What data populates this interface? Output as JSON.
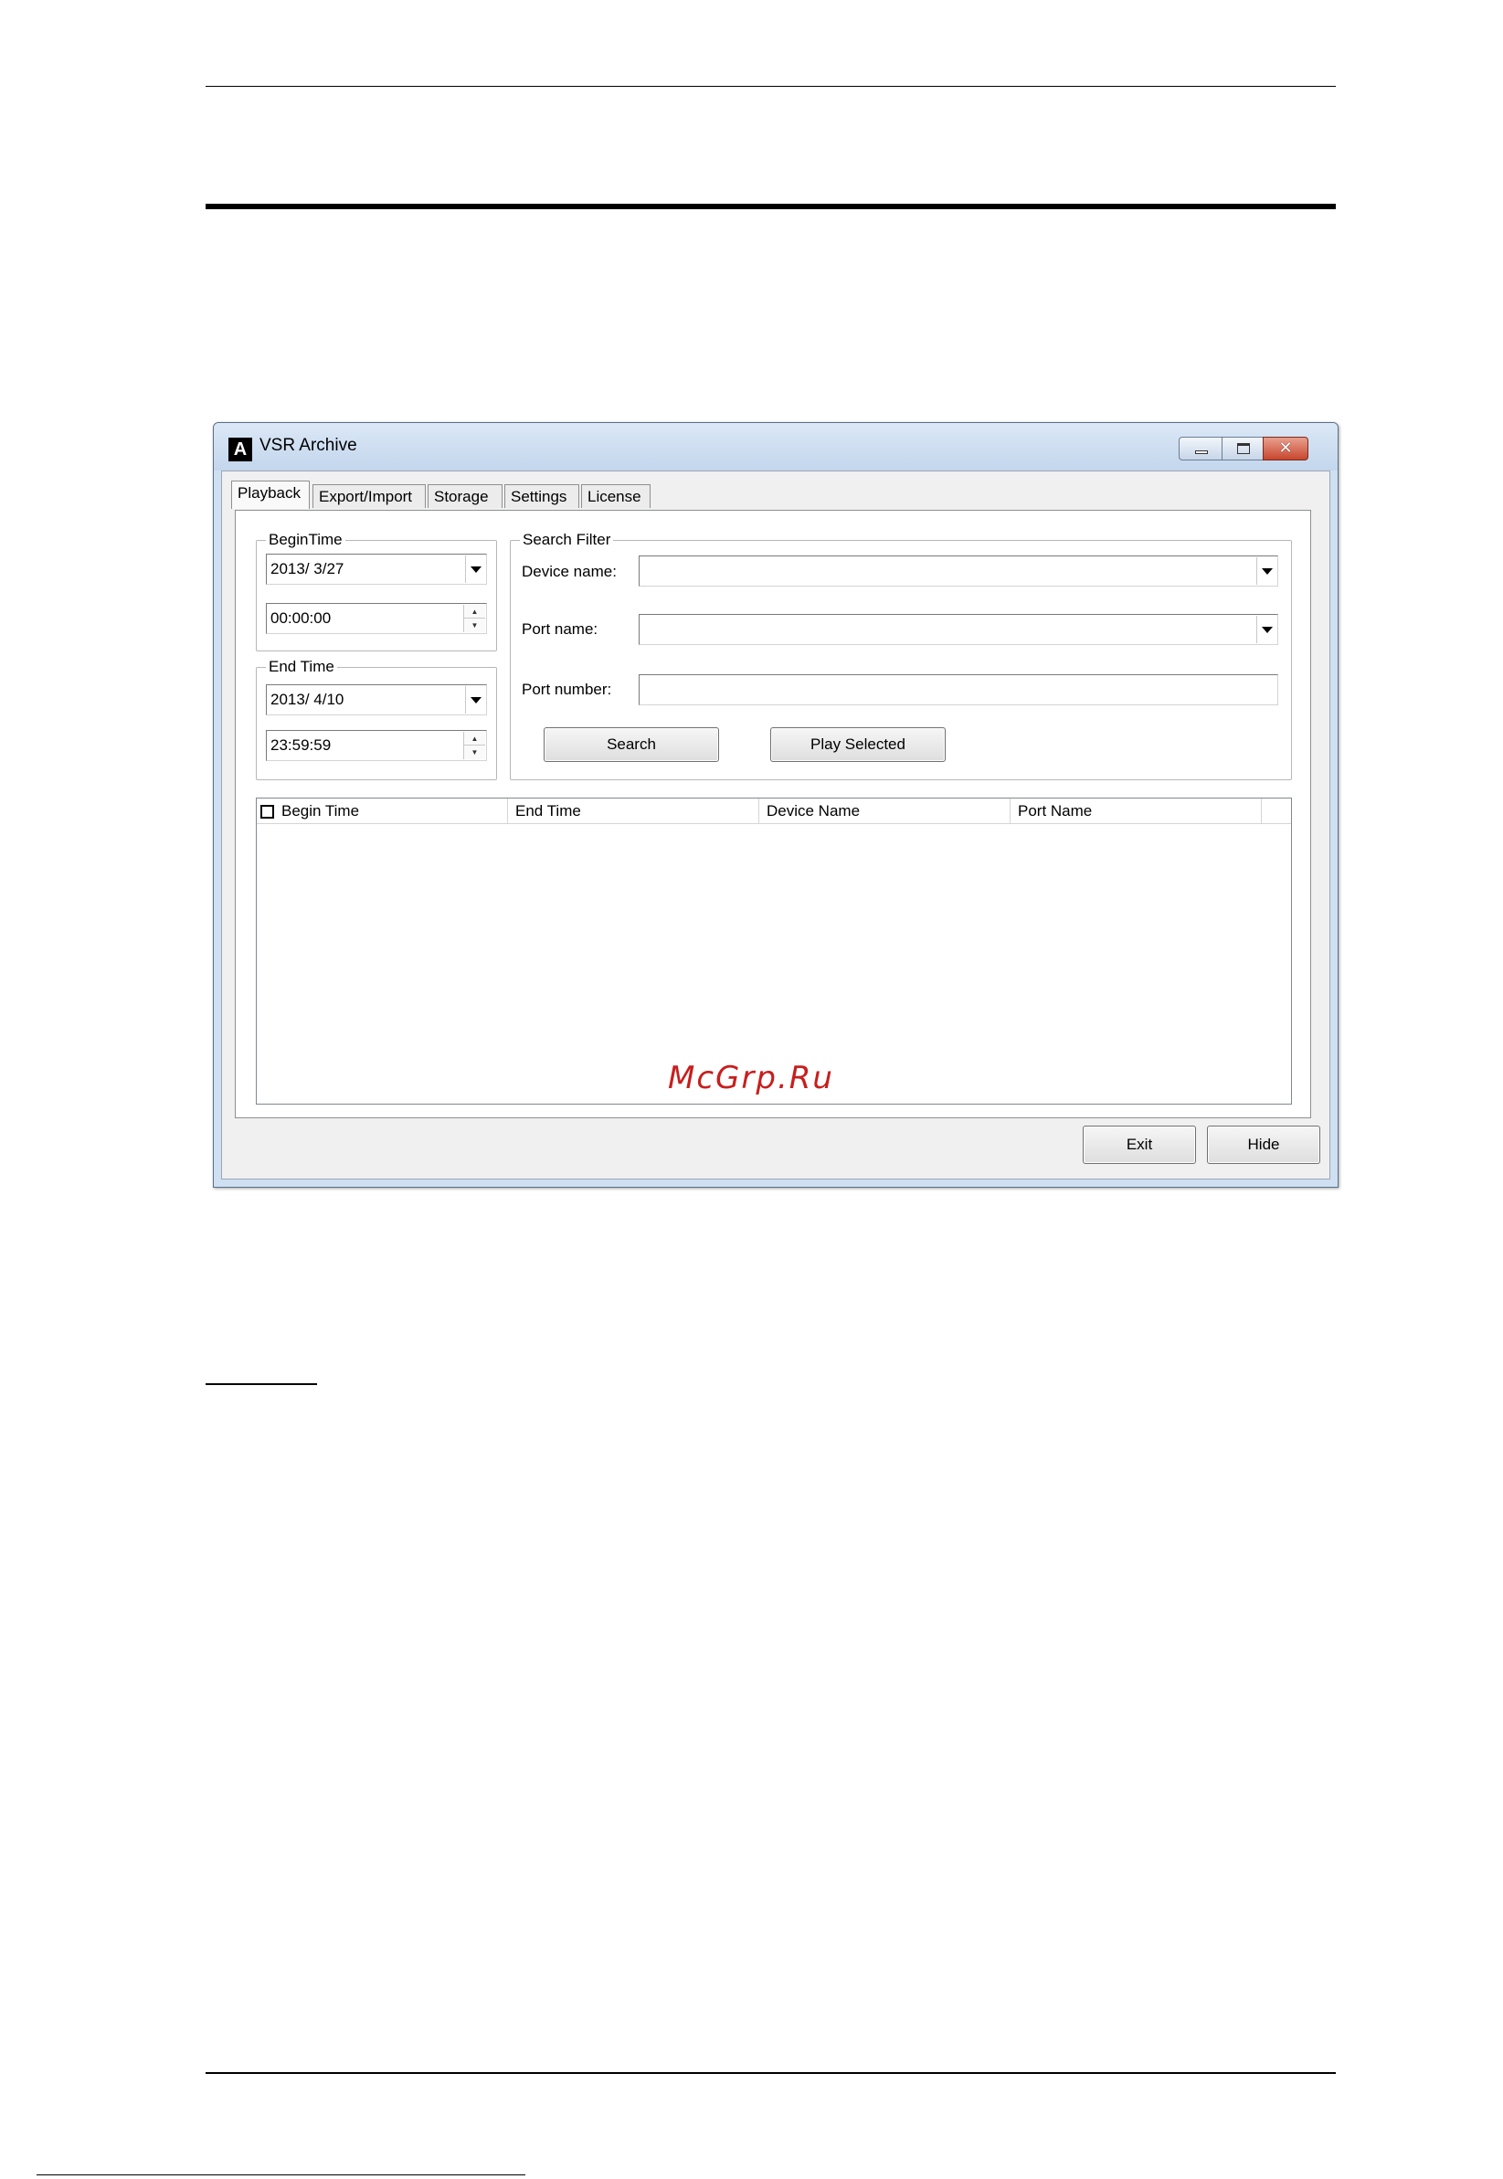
{
  "window": {
    "title": "VSR Archive",
    "icon": "aten-a-logo-icon",
    "controls": [
      "minimize-icon",
      "maximize-icon",
      "close-icon"
    ]
  },
  "tabs": [
    {
      "label": "Playback",
      "active": true
    },
    {
      "label": "Export/Import",
      "active": false
    },
    {
      "label": "Storage",
      "active": false
    },
    {
      "label": "Settings",
      "active": false
    },
    {
      "label": "License",
      "active": false
    }
  ],
  "begin_time": {
    "group_label": "BeginTime",
    "date": "2013/  3/27",
    "time": "00:00:00"
  },
  "end_time": {
    "group_label": "End Time",
    "date": "2013/  4/10",
    "time": "23:59:59"
  },
  "search_filter": {
    "group_label": "Search Filter",
    "device_name_label": "Device name:",
    "device_name_value": "",
    "port_name_label": "Port name:",
    "port_name_value": "",
    "port_number_label": "Port number:",
    "port_number_value": "",
    "search_button": "Search",
    "play_selected_button": "Play Selected"
  },
  "results": {
    "columns": [
      "Begin Time",
      "End Time",
      "Device Name",
      "Port Name"
    ],
    "rows": []
  },
  "footer": {
    "exit_button": "Exit",
    "hide_button": "Hide"
  },
  "watermark": "McGrp.Ru",
  "colors": {
    "titlebar": "#c3d6ec",
    "close_button": "#c8462e",
    "watermark": "#c81e1e"
  }
}
